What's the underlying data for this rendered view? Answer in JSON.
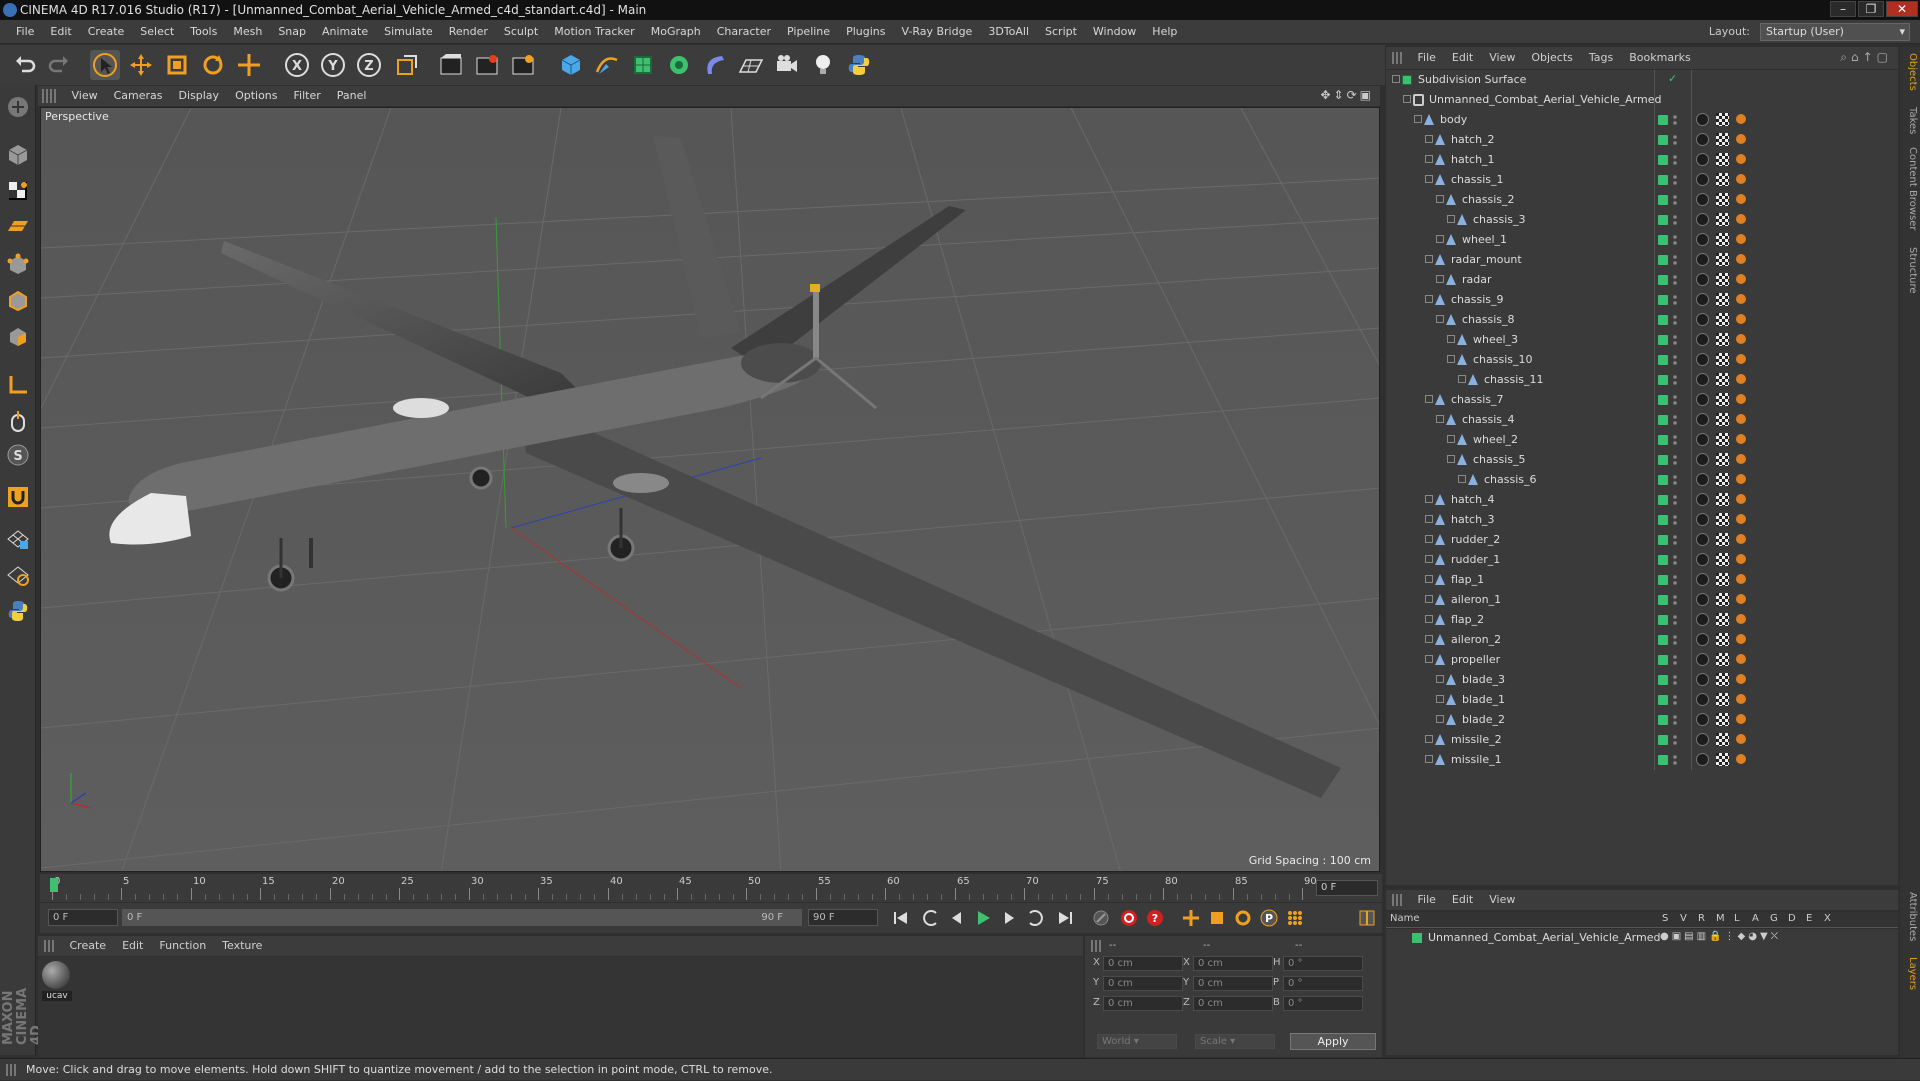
{
  "window": {
    "title": "CINEMA 4D R17.016 Studio (R17) - [Unmanned_Combat_Aerial_Vehicle_Armed_c4d_standart.c4d] - Main"
  },
  "menu": [
    "File",
    "Edit",
    "Create",
    "Select",
    "Tools",
    "Mesh",
    "Snap",
    "Animate",
    "Simulate",
    "Render",
    "Sculpt",
    "Motion Tracker",
    "MoGraph",
    "Character",
    "Pipeline",
    "Plugins",
    "V-Ray Bridge",
    "3DToAll",
    "Script",
    "Window",
    "Help"
  ],
  "layout": {
    "label": "Layout:",
    "value": "Startup (User)"
  },
  "viewport": {
    "menu": [
      "View",
      "Cameras",
      "Display",
      "Options",
      "Filter",
      "Panel"
    ],
    "label": "Perspective",
    "grid_spacing": "Grid Spacing : 100 cm"
  },
  "timeline": {
    "ticks": [
      "0",
      "5",
      "10",
      "15",
      "20",
      "25",
      "30",
      "35",
      "40",
      "45",
      "50",
      "55",
      "60",
      "65",
      "70",
      "75",
      "80",
      "85",
      "90"
    ],
    "current_frame": "0 F"
  },
  "transport": {
    "start": "0 F",
    "range_start": "0 F",
    "range_end": "90 F",
    "end": "90 F"
  },
  "material_manager": {
    "menu": [
      "Create",
      "Edit",
      "Function",
      "Texture"
    ],
    "materials": [
      {
        "name": "ucav"
      }
    ]
  },
  "coords": {
    "header": [
      "--",
      "--",
      "--"
    ],
    "rows": [
      {
        "a": "X",
        "av": "0 cm",
        "b": "X",
        "bv": "0 cm",
        "c": "H",
        "cv": "0 °"
      },
      {
        "a": "Y",
        "av": "0 cm",
        "b": "Y",
        "bv": "0 cm",
        "c": "P",
        "cv": "0 °"
      },
      {
        "a": "Z",
        "av": "0 cm",
        "b": "Z",
        "bv": "0 cm",
        "c": "B",
        "cv": "0 °"
      }
    ],
    "mode": "World",
    "scale": "Scale",
    "apply": "Apply"
  },
  "objects_panel": {
    "menu": [
      "File",
      "Edit",
      "View",
      "Objects",
      "Tags",
      "Bookmarks"
    ],
    "items": [
      {
        "name": "Subdivision Surface",
        "depth": 0,
        "tags": false
      },
      {
        "name": "Unmanned_Combat_Aerial_Vehicle_Armed",
        "depth": 1,
        "tags": false
      },
      {
        "name": "body",
        "depth": 2,
        "tags": true
      },
      {
        "name": "hatch_2",
        "depth": 3,
        "tags": true
      },
      {
        "name": "hatch_1",
        "depth": 3,
        "tags": true
      },
      {
        "name": "chassis_1",
        "depth": 3,
        "tags": true
      },
      {
        "name": "chassis_2",
        "depth": 4,
        "tags": true
      },
      {
        "name": "chassis_3",
        "depth": 5,
        "tags": true
      },
      {
        "name": "wheel_1",
        "depth": 4,
        "tags": true
      },
      {
        "name": "radar_mount",
        "depth": 3,
        "tags": true
      },
      {
        "name": "radar",
        "depth": 4,
        "tags": true
      },
      {
        "name": "chassis_9",
        "depth": 3,
        "tags": true
      },
      {
        "name": "chassis_8",
        "depth": 4,
        "tags": true
      },
      {
        "name": "wheel_3",
        "depth": 5,
        "tags": true
      },
      {
        "name": "chassis_10",
        "depth": 5,
        "tags": true
      },
      {
        "name": "chassis_11",
        "depth": 6,
        "tags": true
      },
      {
        "name": "chassis_7",
        "depth": 3,
        "tags": true
      },
      {
        "name": "chassis_4",
        "depth": 4,
        "tags": true
      },
      {
        "name": "wheel_2",
        "depth": 5,
        "tags": true
      },
      {
        "name": "chassis_5",
        "depth": 5,
        "tags": true
      },
      {
        "name": "chassis_6",
        "depth": 6,
        "tags": true
      },
      {
        "name": "hatch_4",
        "depth": 3,
        "tags": true
      },
      {
        "name": "hatch_3",
        "depth": 3,
        "tags": true
      },
      {
        "name": "rudder_2",
        "depth": 3,
        "tags": true
      },
      {
        "name": "rudder_1",
        "depth": 3,
        "tags": true
      },
      {
        "name": "flap_1",
        "depth": 3,
        "tags": true
      },
      {
        "name": "aileron_1",
        "depth": 3,
        "tags": true
      },
      {
        "name": "flap_2",
        "depth": 3,
        "tags": true
      },
      {
        "name": "aileron_2",
        "depth": 3,
        "tags": true
      },
      {
        "name": "propeller",
        "depth": 3,
        "tags": true
      },
      {
        "name": "blade_3",
        "depth": 4,
        "tags": true
      },
      {
        "name": "blade_1",
        "depth": 4,
        "tags": true
      },
      {
        "name": "blade_2",
        "depth": 4,
        "tags": true
      },
      {
        "name": "missile_2",
        "depth": 3,
        "tags": true
      },
      {
        "name": "missile_1",
        "depth": 3,
        "tags": true
      }
    ]
  },
  "attributes_panel": {
    "menu": [
      "File",
      "Edit",
      "View"
    ],
    "columns": [
      "Name",
      "S",
      "V",
      "R",
      "M",
      "L",
      "A",
      "G",
      "D",
      "E",
      "X"
    ],
    "rows": [
      {
        "name": "Unmanned_Combat_Aerial_Vehicle_Armed"
      }
    ]
  },
  "right_tabs": [
    "Objects",
    "Takes",
    "Content Browser",
    "Structure",
    "Attributes",
    "Layers"
  ],
  "status": "Move: Click and drag to move elements. Hold down SHIFT to quantize movement / add to the selection in point mode, CTRL to remove.",
  "brand": "MAXON CINEMA 4D"
}
